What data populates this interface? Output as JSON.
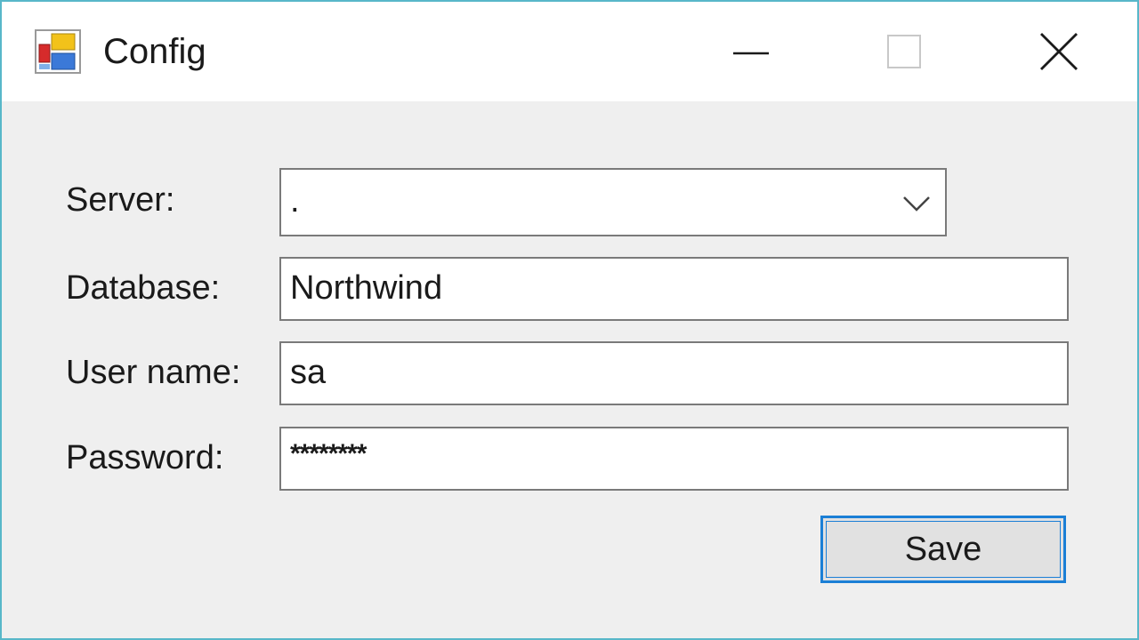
{
  "window": {
    "title": "Config",
    "icon": "winforms-app-icon",
    "controls": {
      "minimize_icon": "minimize-icon",
      "maximize_icon": "maximize-icon",
      "close_icon": "close-icon"
    }
  },
  "form": {
    "server": {
      "label": "Server:",
      "value": ".",
      "icon": "chevron-down-icon"
    },
    "database": {
      "label": "Database:",
      "value": "Northwind"
    },
    "username": {
      "label": "User name:",
      "value": "sa"
    },
    "password": {
      "label": "Password:",
      "value": "********"
    },
    "save_label": "Save"
  },
  "colors": {
    "window_border": "#58b7c9",
    "client_background": "#efefef",
    "focus_accent": "#1b7fd6"
  }
}
